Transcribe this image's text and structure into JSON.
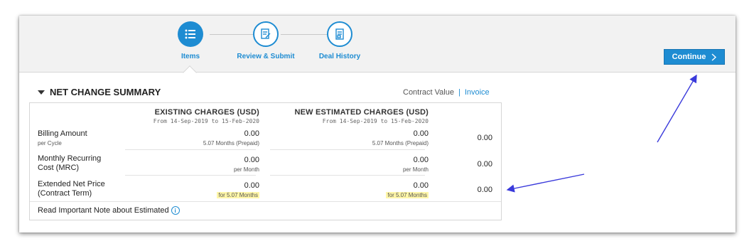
{
  "steps": [
    {
      "label": "Items",
      "icon": "list-icon",
      "active": true
    },
    {
      "label": "Review & Submit",
      "icon": "document-edit-icon",
      "active": false
    },
    {
      "label": "Deal History",
      "icon": "history-document-icon",
      "active": false
    }
  ],
  "continue_button": {
    "label": "Continue",
    "icon": "chevron-right-icon"
  },
  "section": {
    "title": "NET CHANGE SUMMARY",
    "collapse_icon": "caret-down-icon"
  },
  "view_links": {
    "contract_value": "Contract Value",
    "separator": "|",
    "invoice": "Invoice"
  },
  "table": {
    "existing": {
      "title": "EXISTING CHARGES (USD)",
      "range": "From 14-Sep-2019 to 15-Feb-2020"
    },
    "new": {
      "title": "NEW ESTIMATED CHARGES (USD)",
      "range": "From 14-Sep-2019 to 15-Feb-2020"
    },
    "rows": [
      {
        "label": "Billing Amount",
        "sublabel": "per Cycle",
        "existing": "0.00",
        "existing_sub": "5.07 Months (Prepaid)",
        "new": "0.00",
        "new_sub": "5.07 Months (Prepaid)",
        "net": "0.00"
      },
      {
        "label_line1": "Monthly Recurring",
        "label_line2": "Cost (MRC)",
        "existing": "0.00",
        "existing_sub": "per Month",
        "new": "0.00",
        "new_sub": "per Month",
        "net": "0.00"
      },
      {
        "label_line1": "Extended Net Price",
        "label_line2": "(Contract Term)",
        "existing": "0.00",
        "existing_sub": "for 5.07 Months",
        "new": "0.00",
        "new_sub": "for 5.07 Months",
        "net": "0.00"
      }
    ],
    "note": "Read Important Note about Estimated",
    "note_icon": "info-icon"
  },
  "colors": {
    "accent": "#1e8cd2",
    "highlight": "#fff6a8",
    "annotation_arrow": "#3a3adb"
  }
}
